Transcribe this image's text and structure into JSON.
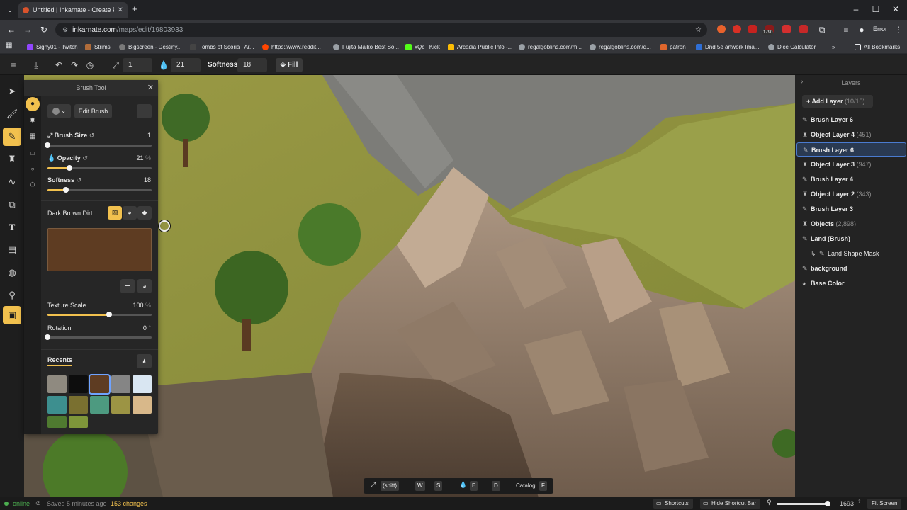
{
  "browser": {
    "tab_title": "Untitled | Inkarnate - Create Fa",
    "url_domain": "inkarnate.com",
    "url_path": "/maps/edit/19803933",
    "error_label": "Error",
    "extension_badge": "1790",
    "bookmarks": [
      "Signy01 - Twitch",
      "Strims",
      "Bigscreen - Destiny...",
      "Tombs of Scoria | Ar...",
      "https://www.reddit...",
      "Fujita Maiko Best So...",
      "xQc | Kick",
      "Arcadia Public Info -...",
      "regalgoblins.com/m...",
      "regalgoblins.com/d...",
      "patron",
      "Dnd 5e artwork Ima...",
      "Dice Calculator"
    ],
    "all_bookmarks": "All Bookmarks",
    "more_bookmarks": "»"
  },
  "apptop": {
    "size_value": "1",
    "opacity_value": "21",
    "softness_label": "Softness:",
    "softness_value": "18",
    "fill_label": "Fill"
  },
  "brush_panel": {
    "title": "Brush Tool",
    "edit_brush": "Edit Brush",
    "brush_size_label": "Brush Size",
    "brush_size_value": "1",
    "brush_size_frac": 0.0,
    "opacity_label": "Opacity",
    "opacity_value": "21",
    "opacity_frac": 0.21,
    "softness_label": "Softness",
    "softness_value": "18",
    "softness_frac": 0.18,
    "texture_name": "Dark Brown Dirt",
    "texture_scale_label": "Texture Scale",
    "texture_scale_value": "100",
    "texture_scale_frac": 0.59,
    "rotation_label": "Rotation",
    "rotation_value": "0",
    "rotation_frac": 0.0,
    "recents_label": "Recents",
    "unit_percent": "%",
    "unit_degree": "°",
    "recents_colors": [
      "#8f8a80",
      "#0d0d0d",
      "#5e3c22",
      "#858585",
      "#d9e6f2",
      "#3d8f8f",
      "#7a7030",
      "#4d9a80",
      "#9c9444",
      "#d8b88a",
      "#4f7a30",
      "#7f963a"
    ]
  },
  "layers": {
    "title": "Layers",
    "add_layer": "Add Layer",
    "add_layer_count": "(10/10)",
    "items": [
      {
        "name": "Brush Layer 6",
        "count": "",
        "type": "brush",
        "selected": false
      },
      {
        "name": "Object Layer 4",
        "count": "(451)",
        "type": "object",
        "selected": false
      },
      {
        "name": "Brush Layer 6",
        "count": "",
        "type": "brush",
        "selected": true
      },
      {
        "name": "Object Layer 3",
        "count": "(947)",
        "type": "object",
        "selected": false
      },
      {
        "name": "Brush Layer 4",
        "count": "",
        "type": "brush",
        "selected": false
      },
      {
        "name": "Object Layer 2",
        "count": "(343)",
        "type": "object",
        "selected": false
      },
      {
        "name": "Brush Layer 3",
        "count": "",
        "type": "brush",
        "selected": false
      },
      {
        "name": "Objects",
        "count": "(2,898)",
        "type": "object",
        "selected": false
      },
      {
        "name": "Land (Brush)",
        "count": "",
        "type": "brush",
        "selected": false
      },
      {
        "name": "Land Shape Mask",
        "count": "",
        "type": "mask",
        "selected": false
      },
      {
        "name": "background",
        "count": "",
        "type": "brush",
        "selected": false
      },
      {
        "name": "Base Color",
        "count": "",
        "type": "color",
        "selected": false
      }
    ]
  },
  "shortcut_bar": {
    "shift": "(shift)",
    "w": "W",
    "s": "S",
    "e": "E",
    "d": "D",
    "catalog": "Catalog",
    "f": "F"
  },
  "status": {
    "online": "online",
    "saved": "Saved 5 minutes ago",
    "changes": "153 changes",
    "shortcuts": "Shortcuts",
    "hide_shortcut_bar": "Hide Shortcut Bar",
    "zoom_value": "1693",
    "zoom_frac": 0.95,
    "fit_screen": "Fit Screen"
  },
  "colors": {
    "accent": "#f2c14e",
    "selected_layer_border": "#4a7bd0",
    "online": "#4caf50",
    "changes": "#f2c14e"
  }
}
